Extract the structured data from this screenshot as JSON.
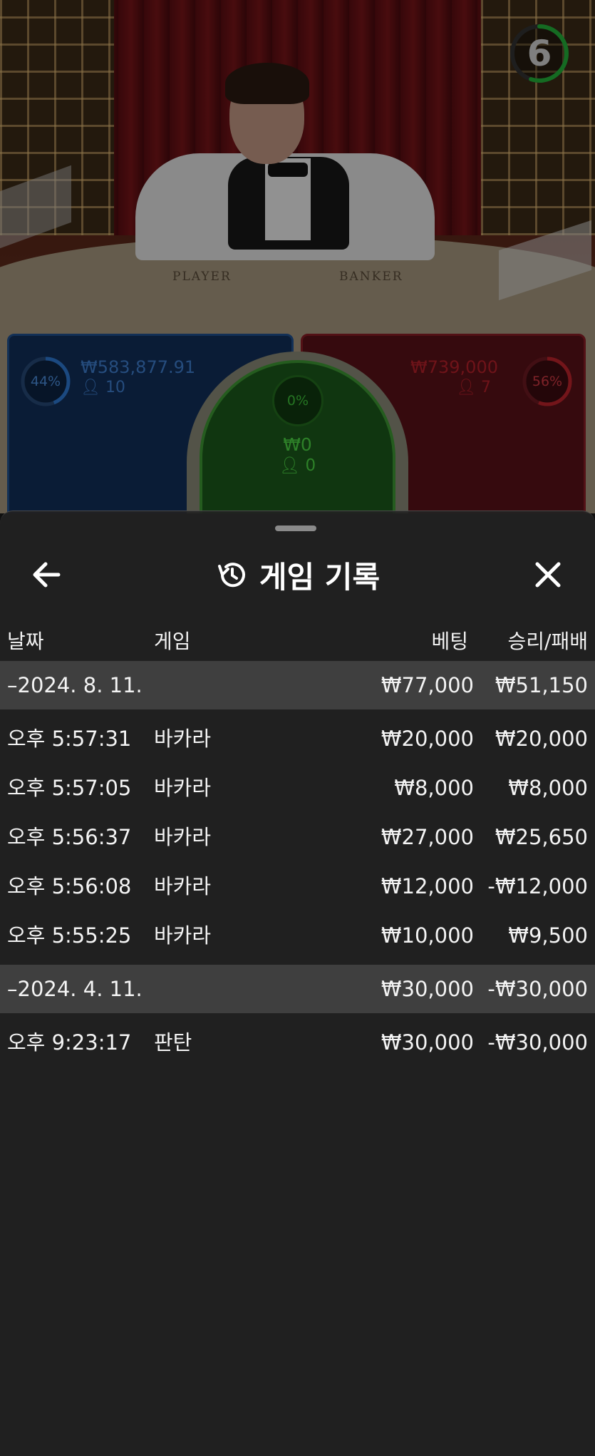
{
  "timer": {
    "value": "6",
    "progress": 0.55
  },
  "table_labels": {
    "player": "PLAYER",
    "banker": "BANKER"
  },
  "player_bet": {
    "percent": "44%",
    "percent_value": 0.44,
    "amount": "₩583,877.91",
    "players": "10"
  },
  "tie_bet": {
    "percent": "0%",
    "amount": "₩0",
    "players": "0"
  },
  "banker_bet": {
    "percent": "56%",
    "percent_value": 0.56,
    "amount": "₩739,000",
    "players": "7"
  },
  "colors": {
    "player": "#1e5aa8",
    "banker": "#b01c24",
    "tie": "#2ea02a",
    "timer": "#23b33a",
    "sheet_bg": "#222222"
  },
  "sheet": {
    "title": "게임 기록",
    "back_icon": "arrow-left-icon",
    "title_icon": "history-icon",
    "close_icon": "close-icon",
    "columns": {
      "date": "날짜",
      "game": "게임",
      "bet": "베팅",
      "result": "승리/패배"
    },
    "groups": [
      {
        "date": "–2024. 8. 11.",
        "bet_total": "₩77,000",
        "result_total": "₩51,150",
        "rows": [
          {
            "time": "오후 5:57:31",
            "game": "바카라",
            "bet": "₩20,000",
            "result": "₩20,000"
          },
          {
            "time": "오후 5:57:05",
            "game": "바카라",
            "bet": "₩8,000",
            "result": "₩8,000"
          },
          {
            "time": "오후 5:56:37",
            "game": "바카라",
            "bet": "₩27,000",
            "result": "₩25,650"
          },
          {
            "time": "오후 5:56:08",
            "game": "바카라",
            "bet": "₩12,000",
            "result": "-₩12,000"
          },
          {
            "time": "오후 5:55:25",
            "game": "바카라",
            "bet": "₩10,000",
            "result": "₩9,500"
          }
        ]
      },
      {
        "date": "–2024. 4. 11.",
        "bet_total": "₩30,000",
        "result_total": "-₩30,000",
        "rows": [
          {
            "time": "오후 9:23:17",
            "game": "판탄",
            "bet": "₩30,000",
            "result": "-₩30,000"
          }
        ]
      }
    ]
  }
}
